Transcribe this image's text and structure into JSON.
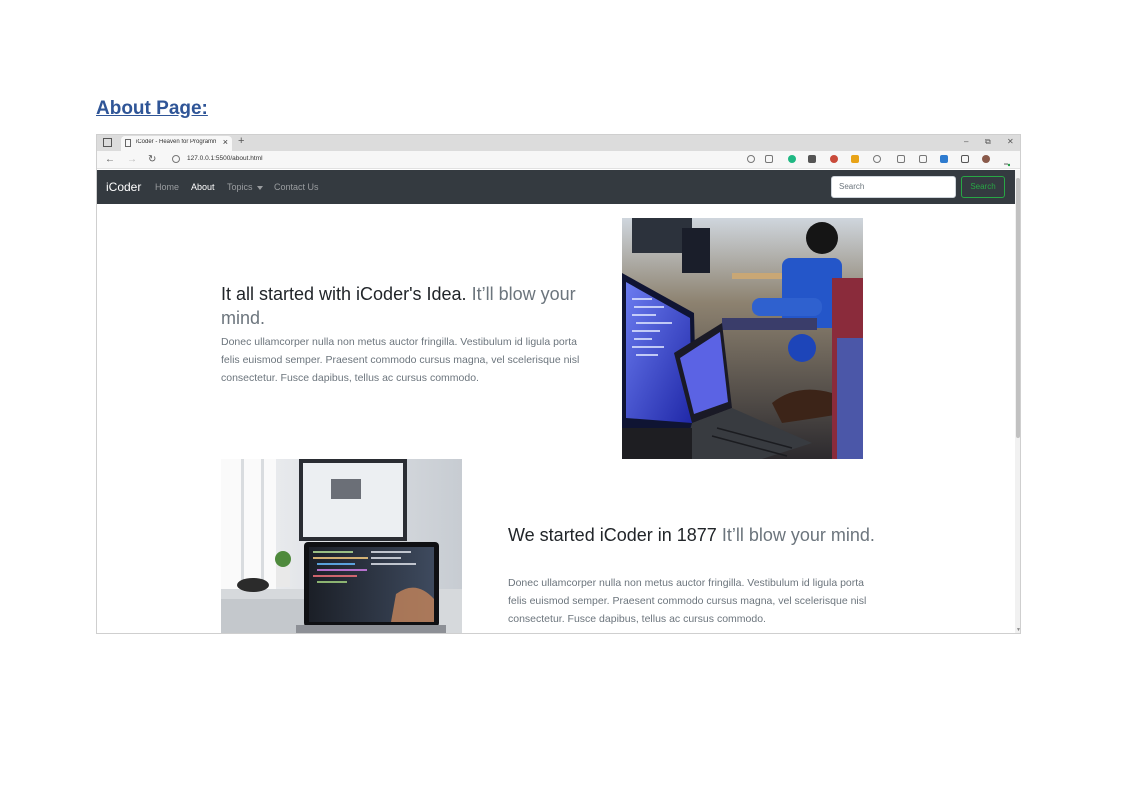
{
  "doc": {
    "heading": "About Page:"
  },
  "browser": {
    "tab_title": "iCoder - Heaven for Programmers",
    "tab_close": "×",
    "new_tab": "+",
    "url": "127.0.0.1:5500/about.html",
    "window_controls": {
      "minimize": "–",
      "restore": "⧉",
      "close": "✕"
    }
  },
  "navbar": {
    "brand": "iCoder",
    "links": [
      {
        "label": "Home"
      },
      {
        "label": "About"
      },
      {
        "label": "Topics"
      },
      {
        "label": "Contact Us"
      }
    ],
    "search": {
      "placeholder": "Search",
      "button": "Search"
    }
  },
  "features": [
    {
      "heading": "It all started with iCoder's Idea.",
      "heading_muted": "It’ll blow your mind.",
      "text": "Donec ullamcorper nulla non metus auctor fringilla. Vestibulum id ligula porta felis euismod semper. Praesent commodo cursus magna, vel scelerisque nisl consectetur. Fusce dapibus, tellus ac cursus commodo."
    },
    {
      "heading": "We started iCoder in 1877",
      "heading_muted": "It’ll blow your mind.",
      "text": "Donec ullamcorper nulla non metus auctor fringilla. Vestibulum id ligula porta felis euismod semper. Praesent commodo cursus magna, vel scelerisque nisl consectetur. Fusce dapibus, tellus ac cursus commodo."
    }
  ],
  "colors": {
    "navbar_bg": "#343a40",
    "search_button": "#28a745",
    "heading_link": "#2f5597"
  }
}
